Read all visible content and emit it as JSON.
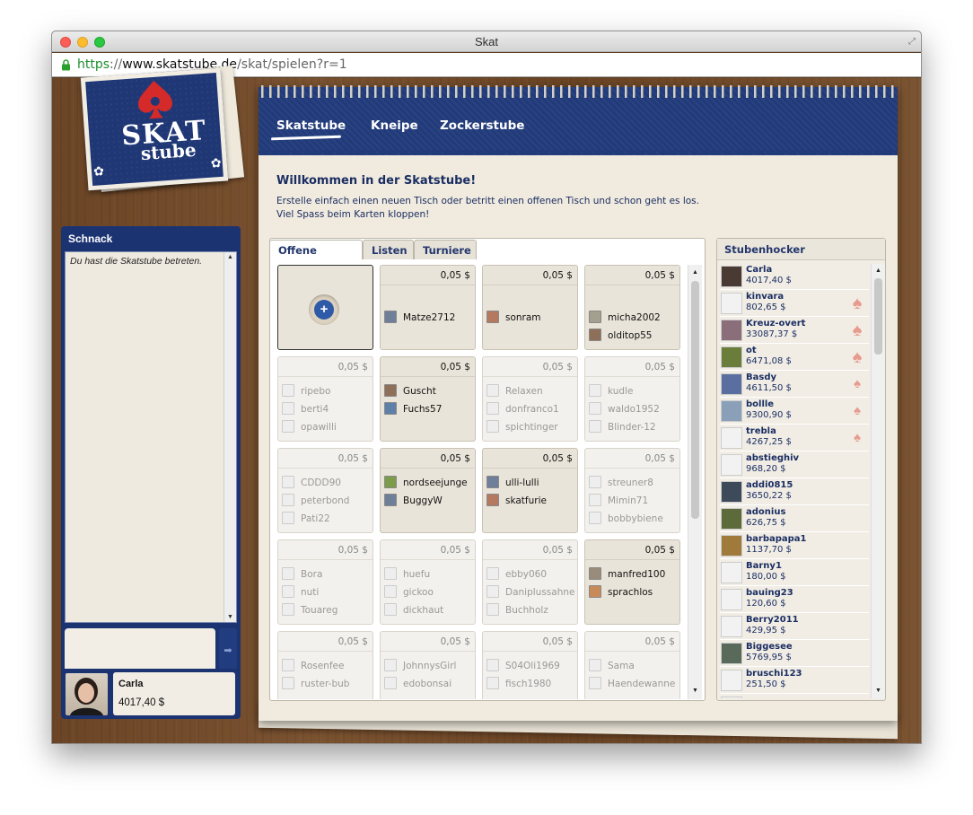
{
  "window": {
    "title": "Skat"
  },
  "address": {
    "scheme": "https",
    "sep": "://",
    "host": "www.skatstube.de",
    "path": "/skat/spielen?r=1"
  },
  "logo": {
    "line1": "SKAT",
    "line2": "stube"
  },
  "chat": {
    "title": "Schnack",
    "message": "Du hast die Skatstube betreten.",
    "input_value": ""
  },
  "profile": {
    "name": "Carla",
    "balance": "4017,40 $"
  },
  "nav": {
    "items": [
      "Skatstube",
      "Kneipe",
      "Zockerstube"
    ],
    "active": "Skatstube"
  },
  "welcome": {
    "title": "Willkommen in der Skatstube!",
    "line1": "Erstelle einfach einen neuen Tisch oder betritt einen offenen Tisch und schon geht es los.",
    "line2": "Viel Spass beim Karten kloppen!"
  },
  "tabs": [
    "Offene Tische",
    "Listen",
    "Turniere"
  ],
  "active_tab": "Offene Tische",
  "tables": [
    {
      "new": true,
      "stake": "",
      "active": false,
      "players": []
    },
    {
      "stake": "0,05 $",
      "active": true,
      "players": [
        "",
        "Matze2712"
      ]
    },
    {
      "stake": "0,05 $",
      "active": true,
      "players": [
        "",
        "sonram"
      ]
    },
    {
      "stake": "0,05 $",
      "active": true,
      "players": [
        "",
        "micha2002",
        "olditop55"
      ]
    },
    {
      "stake": "0,05 $",
      "active": false,
      "players": [
        "ripebo",
        "berti4",
        "opawilli"
      ]
    },
    {
      "stake": "0,05 $",
      "active": true,
      "players": [
        "Guscht",
        "Fuchs57"
      ]
    },
    {
      "stake": "0,05 $",
      "active": false,
      "players": [
        "Relaxen",
        "donfranco1",
        "spichtinger"
      ]
    },
    {
      "stake": "0,05 $",
      "active": false,
      "players": [
        "kudle",
        "waldo1952",
        "Blinder-12"
      ]
    },
    {
      "stake": "0,05 $",
      "active": false,
      "players": [
        "CDDD90",
        "peterbond",
        "Pati22"
      ]
    },
    {
      "stake": "0,05 $",
      "active": true,
      "players": [
        "nordseejunge",
        "BuggyW"
      ]
    },
    {
      "stake": "0,05 $",
      "active": true,
      "players": [
        "ulli-lulli",
        "skatfurie"
      ]
    },
    {
      "stake": "0,05 $",
      "active": false,
      "players": [
        "streuner8",
        "Mimin71",
        "bobbybiene"
      ]
    },
    {
      "stake": "0,05 $",
      "active": false,
      "players": [
        "Bora",
        "nuti",
        "Touareg"
      ]
    },
    {
      "stake": "0,05 $",
      "active": false,
      "players": [
        "huefu",
        "gickoo",
        "dickhaut"
      ]
    },
    {
      "stake": "0,05 $",
      "active": false,
      "players": [
        "ebby060",
        "Daniplussahne",
        "Buchholz"
      ]
    },
    {
      "stake": "0,05 $",
      "active": true,
      "players": [
        "manfred100",
        "sprachlos"
      ]
    },
    {
      "stake": "0,05 $",
      "active": false,
      "players": [
        "Rosenfee",
        "ruster-bub"
      ]
    },
    {
      "stake": "0,05 $",
      "active": false,
      "players": [
        "JohnnysGirl",
        "edobonsai"
      ]
    },
    {
      "stake": "0,05 $",
      "active": false,
      "players": [
        "S04Oli1969",
        "fisch1980"
      ]
    },
    {
      "stake": "0,05 $",
      "active": false,
      "players": [
        "Sama",
        "Haendewanne"
      ]
    }
  ],
  "users": {
    "title": "Stubenhocker",
    "list": [
      {
        "name": "Carla",
        "balance": "4017,40 $",
        "spade": ""
      },
      {
        "name": "kinvara",
        "balance": "802,65 $",
        "spade": "big"
      },
      {
        "name": "Kreuz-overt",
        "balance": "33087,37 $",
        "spade": "big"
      },
      {
        "name": "ot",
        "balance": "6471,08 $",
        "spade": "big"
      },
      {
        "name": "Basdy",
        "balance": "4611,50 $",
        "spade": "small"
      },
      {
        "name": "bollle",
        "balance": "9300,90 $",
        "spade": "small"
      },
      {
        "name": "trebla",
        "balance": "4267,25 $",
        "spade": "small"
      },
      {
        "name": "abstieghiv",
        "balance": "968,20 $",
        "spade": ""
      },
      {
        "name": "addi0815",
        "balance": "3650,22 $",
        "spade": ""
      },
      {
        "name": "adonius",
        "balance": "626,75 $",
        "spade": ""
      },
      {
        "name": "barbapapa1",
        "balance": "1137,70 $",
        "spade": ""
      },
      {
        "name": "Barny1",
        "balance": "180,00 $",
        "spade": ""
      },
      {
        "name": "bauing23",
        "balance": "120,60 $",
        "spade": ""
      },
      {
        "name": "Berry2011",
        "balance": "429,95 $",
        "spade": ""
      },
      {
        "name": "Biggesee",
        "balance": "5769,95 $",
        "spade": ""
      },
      {
        "name": "bruschi123",
        "balance": "251,50 $",
        "spade": ""
      },
      {
        "name": "",
        "balance": "",
        "spade": ""
      }
    ]
  },
  "colors": {
    "navy": "#1f3775",
    "spade": "#e79b8e",
    "paper": "#f1ebdf"
  }
}
